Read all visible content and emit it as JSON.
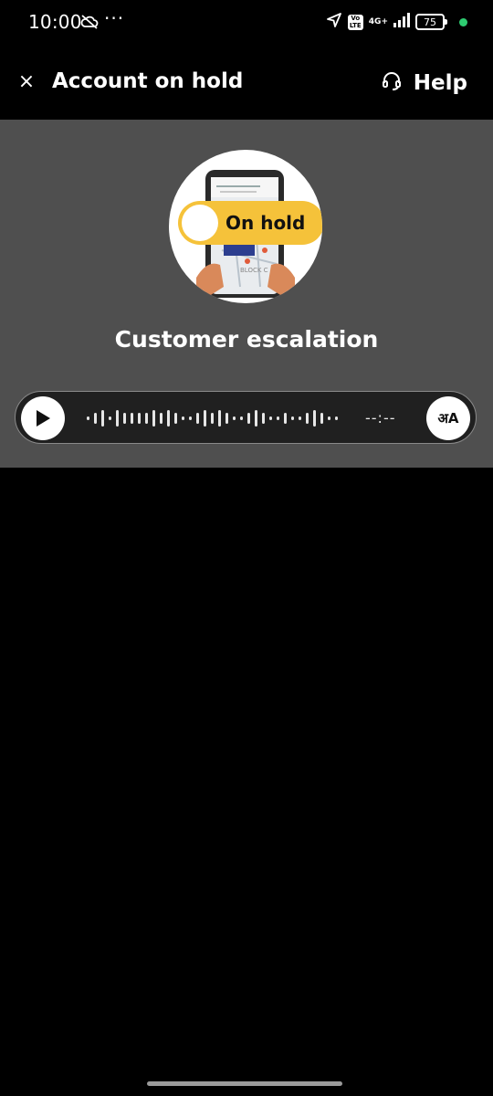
{
  "status_bar": {
    "time": "10:00",
    "more": "···",
    "volte": "Vo LTE",
    "network": "4G+",
    "battery": "75",
    "icons": [
      "cloud-off-icon",
      "location-arrow-icon",
      "signal-icon"
    ]
  },
  "header": {
    "close_glyph": "×",
    "title": "Account on hold",
    "help_label": "Help"
  },
  "hero": {
    "toggle_label": "On hold",
    "map_label": "BLOCK C"
  },
  "subtitle": "Customer escalation",
  "player": {
    "time": "--:--",
    "translate_glyph": "अA"
  },
  "colors": {
    "panel": "#4f4f4f",
    "player_bg": "#202020",
    "accent_yellow": "#f5c23a",
    "status_green": "#2ecc71"
  }
}
